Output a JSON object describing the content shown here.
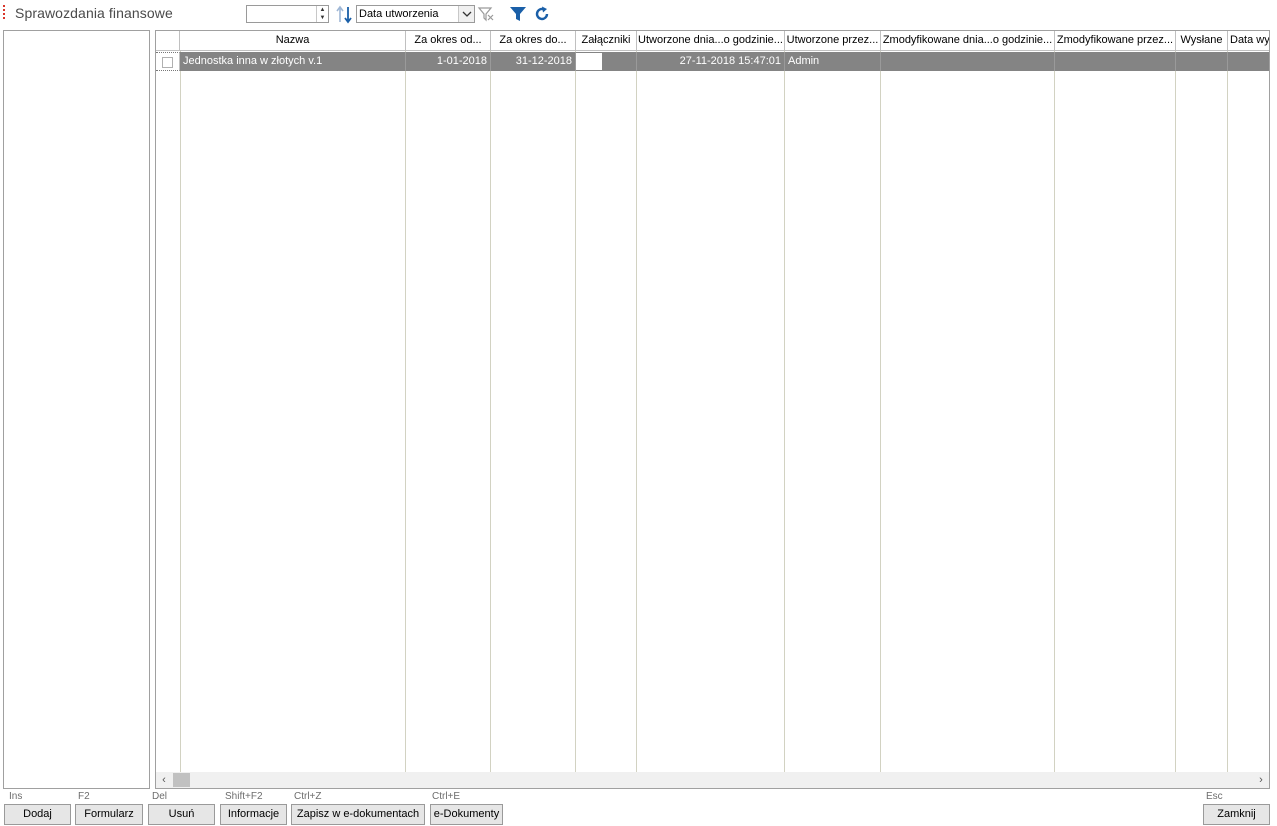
{
  "header": {
    "title": "Sprawozdania finansowe",
    "year_value": "",
    "sort_combo_value": "Data utworzenia"
  },
  "grid": {
    "columns": [
      "Nazwa",
      "Za okres od...",
      "Za okres do...",
      "Załączniki",
      "Utworzone dnia...o godzinie...",
      "Utworzone przez...",
      "Zmodyfikowane dnia...o godzinie...",
      "Zmodyfikowane przez...",
      "Wysłane",
      "Data wy"
    ],
    "rows": [
      {
        "nazwa": "Jednostka inna w złotych v.1",
        "od": "1-01-2018",
        "do": "31-12-2018",
        "zalaczniki": "",
        "utworzone_dnia": "27-11-2018 15:47:01",
        "utworzone_przez": "Admin",
        "zmodyfikowane_dnia": "",
        "zmodyfikowane_przez": "",
        "wyslane": "",
        "data_wys": ""
      }
    ]
  },
  "footer": {
    "buttons": [
      {
        "shortcut": "Ins",
        "label": "Dodaj"
      },
      {
        "shortcut": "F2",
        "label": "Formularz"
      },
      {
        "shortcut": "Del",
        "label": "Usuń"
      },
      {
        "shortcut": "Shift+F2",
        "label": "Informacje"
      },
      {
        "shortcut": "Ctrl+Z",
        "label": "Zapisz w e-dokumentach"
      },
      {
        "shortcut": "Ctrl+E",
        "label": "e-Dokumenty"
      },
      {
        "shortcut": "Esc",
        "label": "Zamknij"
      }
    ]
  },
  "colors": {
    "selected_row": "#848484",
    "title_text": "#4a4a4a",
    "accent_dots": "#d9362b",
    "icon_blue": "#1a5fa8"
  }
}
